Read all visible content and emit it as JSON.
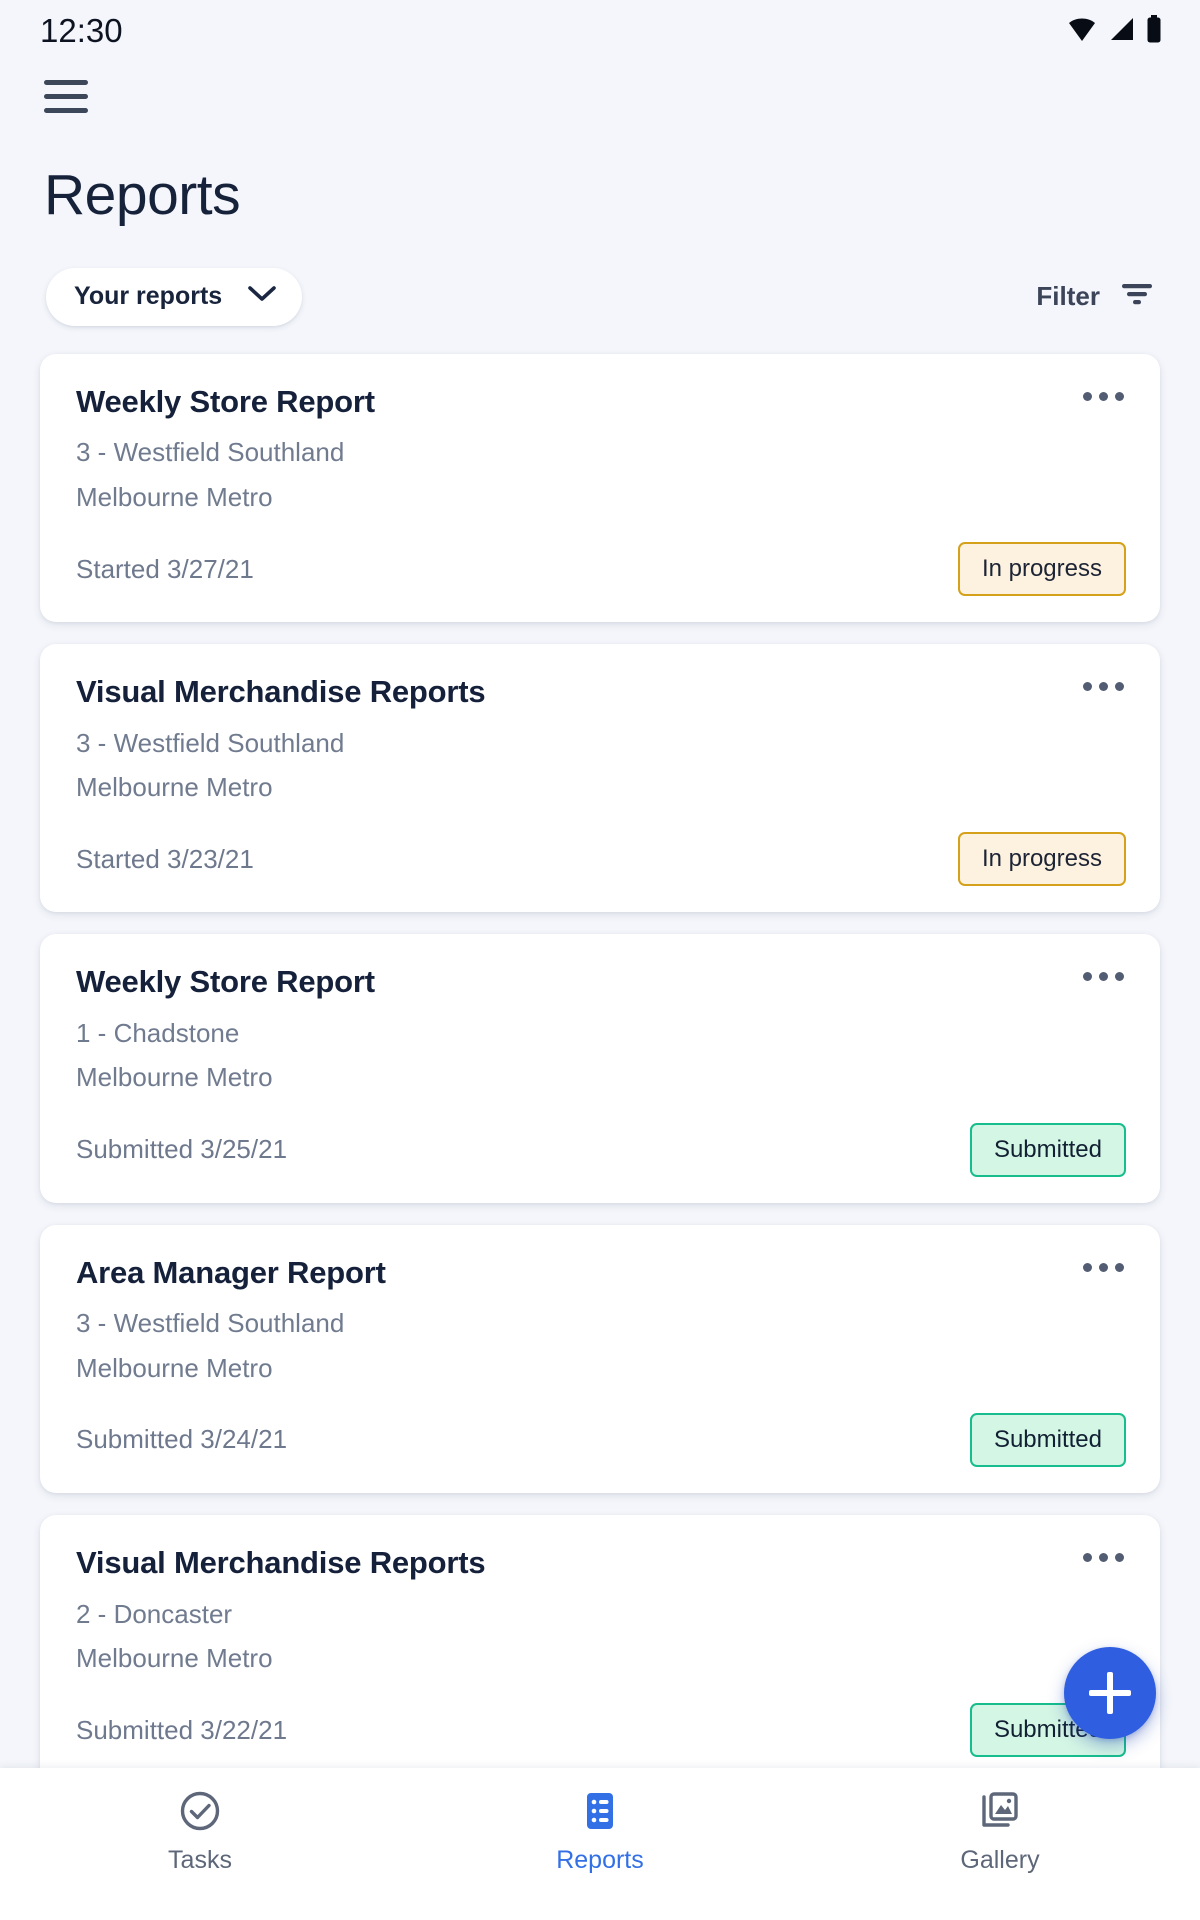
{
  "status_bar": {
    "time": "12:30",
    "icons": [
      "wifi-icon",
      "cellular-signal-icon",
      "battery-icon"
    ]
  },
  "app_bar": {
    "menu_icon": "hamburger-menu-icon"
  },
  "header": {
    "title": "Reports"
  },
  "controls": {
    "scope_selector": {
      "label": "Your reports",
      "icon": "chevron-down-icon"
    },
    "filter": {
      "label": "Filter",
      "icon": "filter-icon"
    }
  },
  "colors": {
    "page_background": "#f4f6fb",
    "card_background": "#ffffff",
    "title_text": "#16213a",
    "secondary_text": "#707b8f",
    "accent_blue": "#2f5fe0",
    "nav_active": "#3370e6",
    "badge_inprogress_border": "#d5a11a",
    "badge_inprogress_fill": "#fdf2e0",
    "badge_submitted_border": "#18bd8d",
    "badge_submitted_fill": "#d4f6e5"
  },
  "reports": [
    {
      "title": "Weekly Store Report",
      "store": "3 - Westfield Southland",
      "region": "Melbourne Metro",
      "date_text": "Started 3/27/21",
      "status": "In progress",
      "status_type": "inprogress",
      "menu_icon": "kebab-menu-icon"
    },
    {
      "title": "Visual Merchandise Reports",
      "store": "3 - Westfield Southland",
      "region": "Melbourne Metro",
      "date_text": "Started 3/23/21",
      "status": "In progress",
      "status_type": "inprogress",
      "menu_icon": "kebab-menu-icon"
    },
    {
      "title": "Weekly Store Report",
      "store": "1 - Chadstone",
      "region": "Melbourne Metro",
      "date_text": "Submitted 3/25/21",
      "status": "Submitted",
      "status_type": "submitted",
      "menu_icon": "kebab-menu-icon"
    },
    {
      "title": "Area Manager Report",
      "store": "3 - Westfield Southland",
      "region": "Melbourne Metro",
      "date_text": "Submitted 3/24/21",
      "status": "Submitted",
      "status_type": "submitted",
      "menu_icon": "kebab-menu-icon"
    },
    {
      "title": "Visual Merchandise Reports",
      "store": "2 - Doncaster",
      "region": "Melbourne Metro",
      "date_text": "Submitted 3/22/21",
      "status": "Submitted",
      "status_type": "submitted",
      "menu_icon": "kebab-menu-icon"
    }
  ],
  "fab": {
    "icon": "plus-icon",
    "label": "Add report"
  },
  "bottom_nav": {
    "items": [
      {
        "label": "Tasks",
        "icon": "check-circle-icon",
        "active": false
      },
      {
        "label": "Reports",
        "icon": "list-icon",
        "active": true
      },
      {
        "label": "Gallery",
        "icon": "photo-stack-icon",
        "active": false
      }
    ]
  }
}
